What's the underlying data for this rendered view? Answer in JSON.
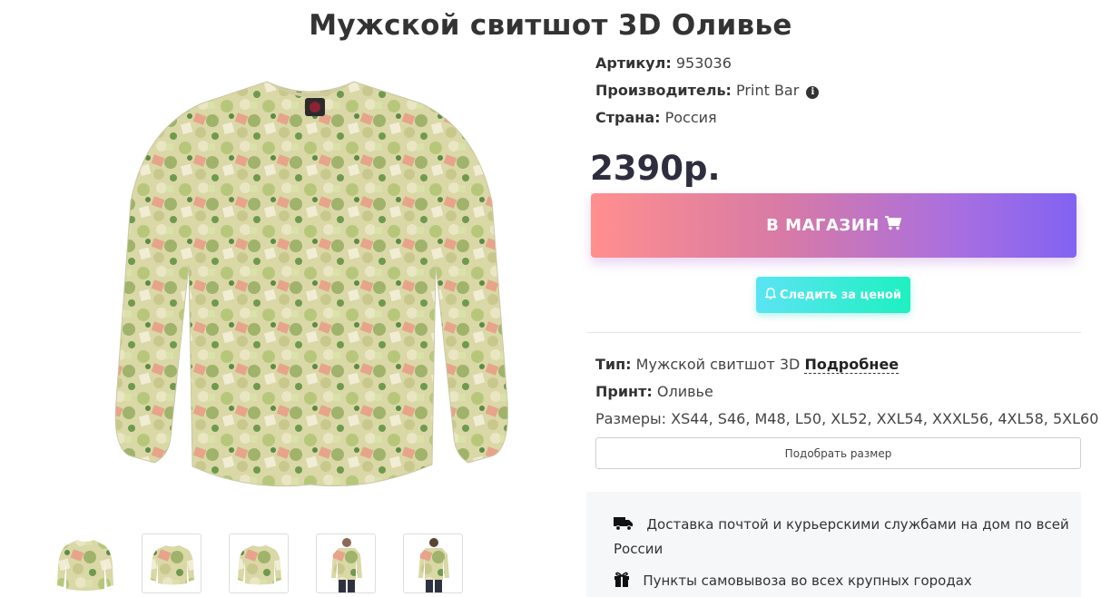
{
  "product": {
    "title": "Мужской свитшот 3D Оливье",
    "article_label": "Артикул:",
    "article_value": "953036",
    "maker_label": "Производитель:",
    "maker_value": "Print Bar",
    "country_label": "Страна:",
    "country_value": "Россия",
    "price": "2390р.",
    "type_label": "Тип:",
    "type_value": "Мужской свитшот 3D",
    "type_more": "Подробнее",
    "print_label": "Принт:",
    "print_value": "Оливье",
    "sizes_label": "Размеры:",
    "sizes_value": "XS44, S46, M48, L50, XL52, XXL54, XXXL56, 4XL58, 5XL60"
  },
  "actions": {
    "shop_label": "В МАГАЗИН",
    "track_label": "Следить за ценой",
    "size_label": "Подобрать размер"
  },
  "delivery": {
    "line1": "Доставка почтой и курьерскими службами на дом по всей",
    "line1b": "России",
    "line2": "Пункты самовывоза во всех крупных городах"
  },
  "icons": {
    "maker_info": "info-circle-icon",
    "cart": "shopping-cart-icon",
    "bell": "bell-icon",
    "truck": "truck-icon",
    "gift": "gift-icon"
  },
  "colors": {
    "shop_gradient_start": "#ff8f8f",
    "shop_gradient_end": "#8163f2",
    "track_gradient_start": "#5be4f3",
    "track_gradient_end": "#1ef0c0",
    "title": "#333333",
    "price": "#2e2e3f"
  }
}
